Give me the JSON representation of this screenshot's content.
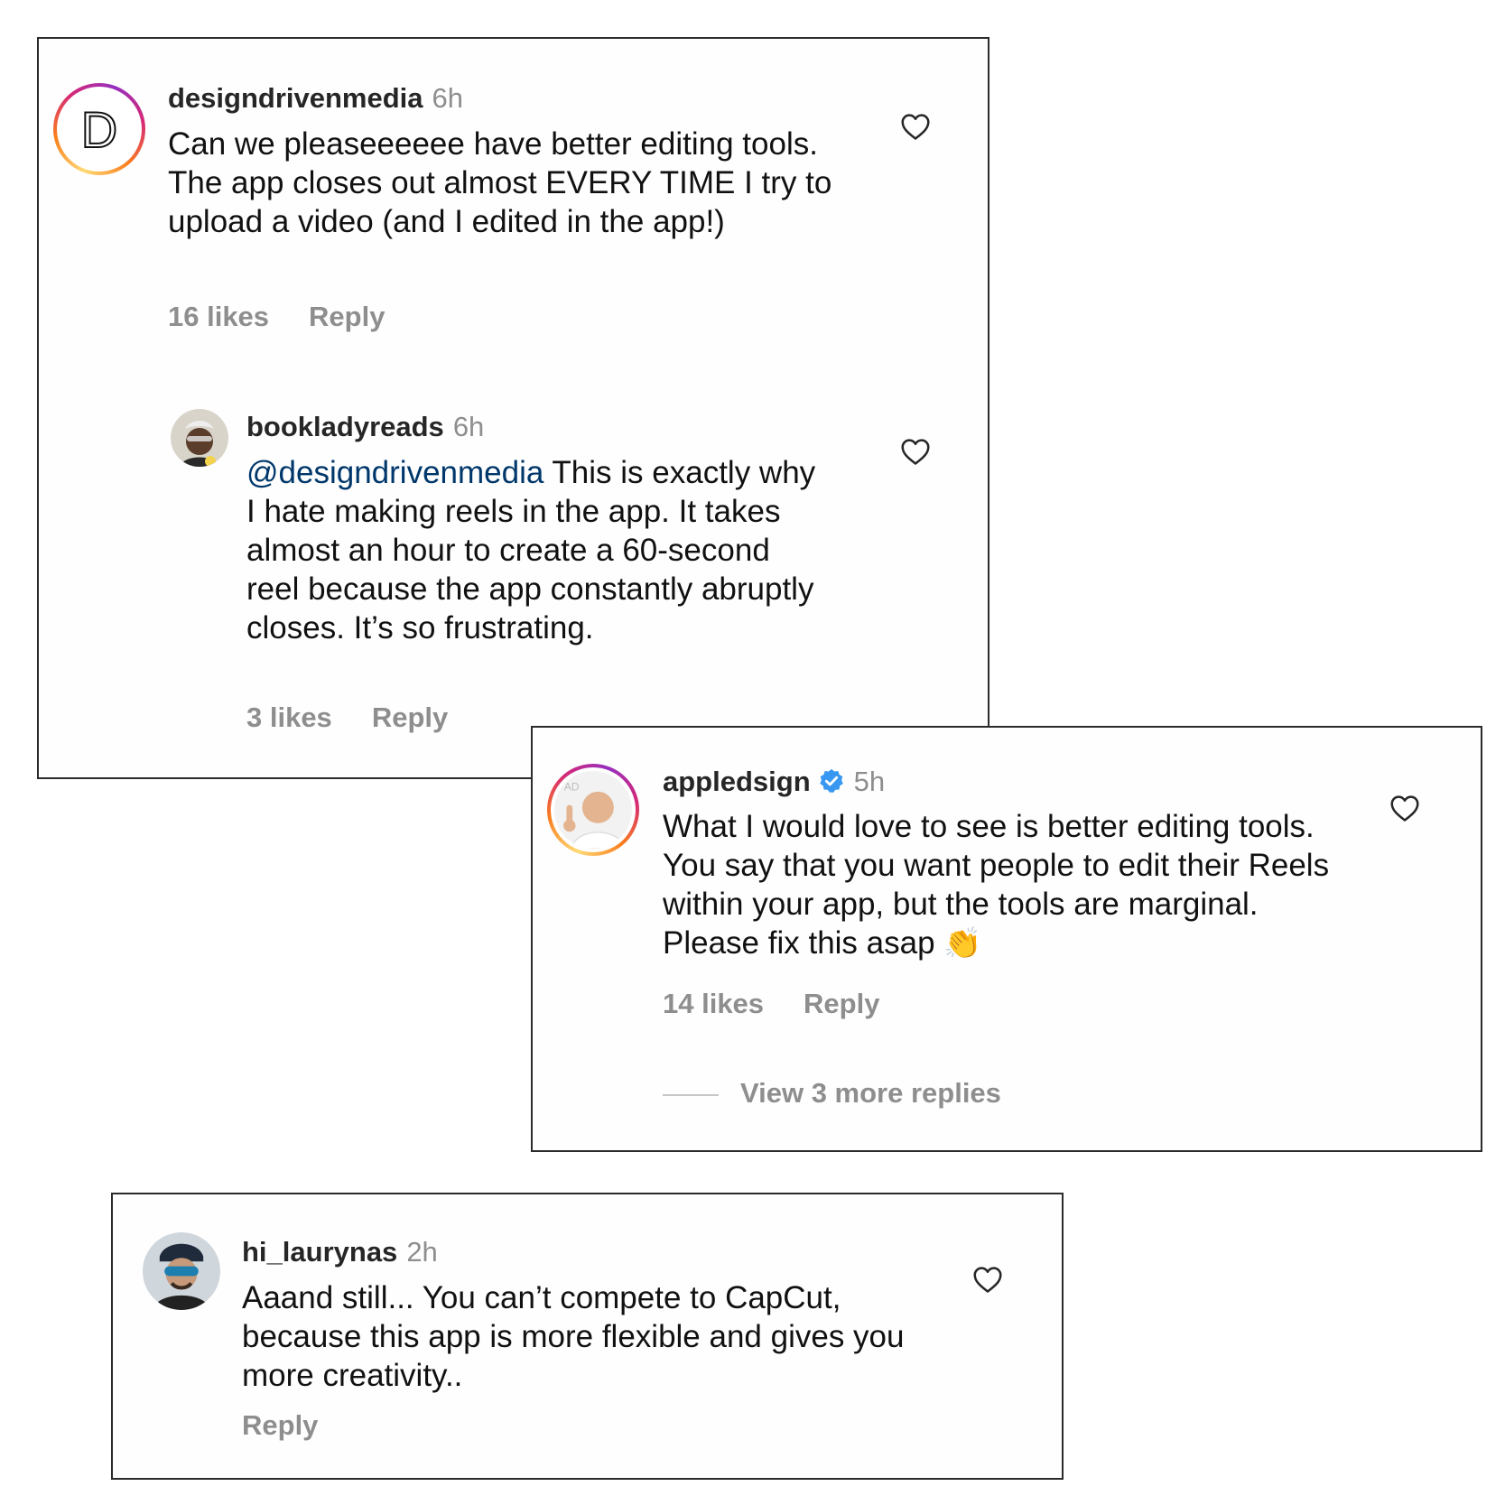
{
  "comments": [
    {
      "username": "designdrivenmedia",
      "time": "6h",
      "text": "Can we pleaseeeeee have better editing tools. The app closes out almost EVERY TIME I try to upload a video (and I edited in the app!)",
      "likes": "16 likes",
      "reply": "Reply",
      "avatar_letter": "D"
    },
    {
      "username": "bookladyreads",
      "time": "6h",
      "mention": "@designdrivenmedia",
      "text": "This is exactly why I hate making reels in the app. It takes almost an hour to create a 60-second reel because the app constantly abruptly closes. It’s so frustrating.",
      "likes": "3 likes",
      "reply": "Reply"
    },
    {
      "username": "appledsign",
      "time": "5h",
      "text": "What I would love to see is better editing tools. You say that you want people to edit their Reels within your app, but the tools are marginal. Please fix this asap",
      "emoji": "👏",
      "likes": "14 likes",
      "reply": "Reply",
      "view_more": "View 3 more replies"
    },
    {
      "username": "hi_laurynas",
      "time": "2h",
      "text": "Aaand still... You can’t compete to CapCut, because this app is more flexible and gives you more creativity..",
      "reply": "Reply"
    }
  ],
  "colors": {
    "verified": "#3897f0",
    "mention": "#00376b",
    "muted": "#8e8e8e"
  },
  "icons": [
    "heart-icon",
    "verified-badge-icon"
  ]
}
